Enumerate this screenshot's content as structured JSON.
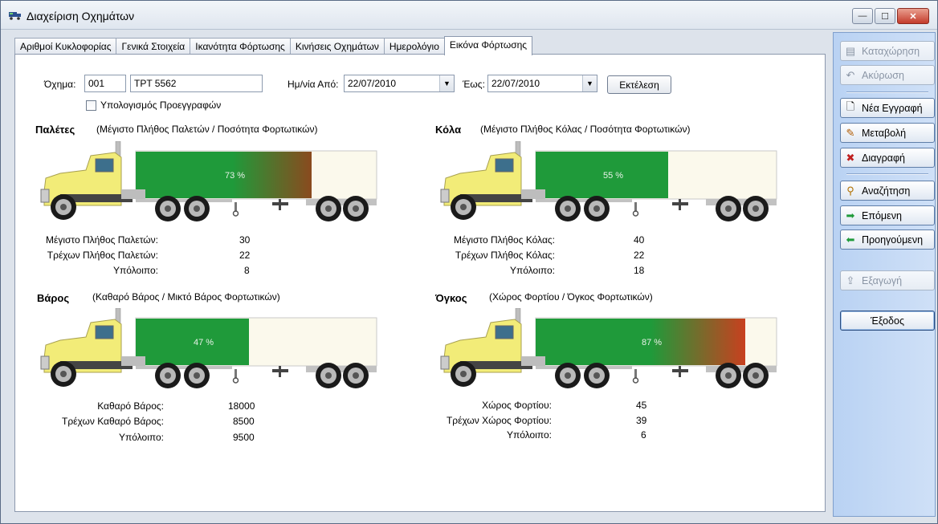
{
  "window": {
    "title": "Διαχείριση Οχημάτων"
  },
  "tabs": [
    "Αριθμοί Κυκλοφορίας",
    "Γενικά Στοιχεία",
    "Ικανότητα Φόρτωσης",
    "Κινήσεις Οχημάτων",
    "Ημερολόγιο",
    "Εικόνα Φόρτωσης"
  ],
  "active_tab": "Εικόνα Φόρτωσης",
  "filters": {
    "vehicle_label": "Όχημα:",
    "vehicle_code": "001",
    "vehicle_plate": "ΤΡΤ 5562",
    "date_from_label": "Ημ/νία Από:",
    "date_from": "22/07/2010",
    "date_to_label": "Έως:",
    "date_to": "22/07/2010",
    "execute_label": "Εκτέλεση",
    "precalc_label": "Υπολογισμός Προεγγραφών",
    "precalc_checked": false
  },
  "sections": {
    "pallets": {
      "title": "Παλέτες",
      "subtitle": "(Μέγιστο Πλήθος Παλετών / Ποσότητα Φορτωτικών)",
      "percent_label": "73 %",
      "fill_fraction": 0.73,
      "gradient_end_color": "#8a4a1e",
      "stats": [
        {
          "label": "Μέγιστο Πλήθος Παλετών:",
          "value": "30"
        },
        {
          "label": "Τρέχων Πλήθος Παλετών:",
          "value": "22"
        },
        {
          "label": "Υπόλοιπο:",
          "value": "8"
        }
      ]
    },
    "parcels": {
      "title": "Κόλα",
      "subtitle": "(Μέγιστο Πλήθος Κόλας / Ποσότητα Φορτωτικών)",
      "percent_label": "55 %",
      "fill_fraction": 0.55,
      "gradient_end_color": "#1f9a3a",
      "stats": [
        {
          "label": "Μέγιστο Πλήθος Κόλας:",
          "value": "40"
        },
        {
          "label": "Τρέχων Πλήθος Κόλας:",
          "value": "22"
        },
        {
          "label": "Υπόλοιπο:",
          "value": "18"
        }
      ]
    },
    "weight": {
      "title": "Βάρος",
      "subtitle": "(Καθαρό Βάρος / Μικτό Βάρος Φορτωτικών)",
      "percent_label": "47 %",
      "fill_fraction": 0.47,
      "gradient_end_color": "#1f9a3a",
      "stats": [
        {
          "label": "Καθαρό Βάρος:",
          "value": "18000"
        },
        {
          "label": "Τρέχων Καθαρό Βάρος:",
          "value": "8500"
        },
        {
          "label": "Υπόλοιπο:",
          "value": "9500"
        }
      ]
    },
    "volume": {
      "title": "Όγκος",
      "subtitle": "(Χώρος Φορτίου / Όγκος Φορτωτικών)",
      "percent_label": "87 %",
      "fill_fraction": 0.87,
      "gradient_end_color": "#c8401f",
      "stats": [
        {
          "label": "Χώρος Φορτίου:",
          "value": "45"
        },
        {
          "label": "Τρέχων Χώρος Φορτίου:",
          "value": "39"
        },
        {
          "label": "Υπόλοιπο:",
          "value": "6"
        }
      ]
    }
  },
  "sidebar": {
    "save": "Καταχώρηση",
    "cancel": "Ακύρωση",
    "new": "Νέα Εγγραφή",
    "edit": "Μεταβολή",
    "delete": "Διαγραφή",
    "search": "Αναζήτηση",
    "next": "Επόμενη",
    "prev": "Προηγούμενη",
    "export": "Εξαγωγή",
    "exit": "Έξοδος"
  },
  "colors": {
    "fill_green": "#1f9a3a",
    "trailer_empty": "#fbf9ec",
    "cab_yellow": "#f2ec78"
  }
}
